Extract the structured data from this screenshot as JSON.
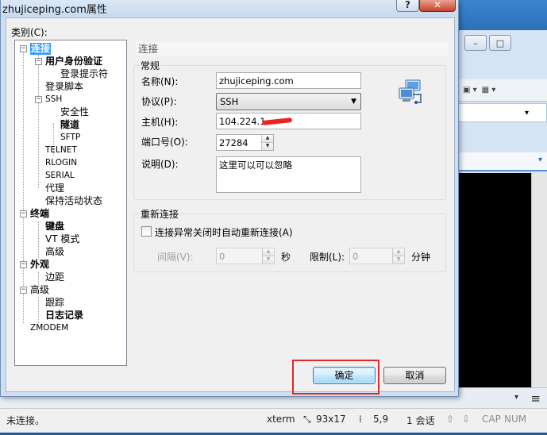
{
  "background_app": {
    "bottom_input_placeholder": "",
    "status_left": "未连接。",
    "status_terminal": "xterm",
    "status_size": "93x17",
    "status_cursor": "5,9",
    "status_sessions": "1 会话",
    "status_caps": "CAP",
    "status_num": "NUM"
  },
  "dialog": {
    "title": "zhujiceping.com属性",
    "help_button": "?",
    "close_button": "✕",
    "category_label": "类别(C):",
    "tree": [
      {
        "label": "连接",
        "bold": true,
        "selected": true
      },
      {
        "label": "用户身份验证",
        "bold": true
      },
      {
        "label": "登录提示符"
      },
      {
        "label": "登录脚本"
      },
      {
        "label": "SSH"
      },
      {
        "label": "安全性"
      },
      {
        "label": "隧道",
        "bold": true
      },
      {
        "label": "SFTP"
      },
      {
        "label": "TELNET"
      },
      {
        "label": "RLOGIN"
      },
      {
        "label": "SERIAL"
      },
      {
        "label": "代理"
      },
      {
        "label": "保持活动状态"
      },
      {
        "label": "终端",
        "bold": true
      },
      {
        "label": "键盘",
        "bold": true
      },
      {
        "label": "VT 模式"
      },
      {
        "label": "高级"
      },
      {
        "label": "外观",
        "bold": true
      },
      {
        "label": "边距"
      },
      {
        "label": "高级"
      },
      {
        "label": "跟踪"
      },
      {
        "label": "日志记录",
        "bold": true
      },
      {
        "label": "ZMODEM"
      }
    ],
    "pane_title": "连接",
    "general": {
      "legend": "常规",
      "name_label": "名称(N):",
      "name_value": "zhujiceping.com",
      "protocol_label": "协议(P):",
      "protocol_value": "SSH",
      "host_label": "主机(H):",
      "host_value": "104.224.1",
      "port_label": "端口号(O):",
      "port_value": "27284",
      "desc_label": "说明(D):",
      "desc_value": "这里可以可以忽略"
    },
    "reconnect": {
      "legend": "重新连接",
      "checkbox_label": "连接异常关闭时自动重新连接(A)",
      "checked": false,
      "interval_label": "间隔(V):",
      "interval_value": "0",
      "interval_unit": "秒",
      "limit_label": "限制(L):",
      "limit_value": "0",
      "limit_unit": "分钟"
    },
    "ok_button": "确定",
    "cancel_button": "取消",
    "highlight_color": "#e0292b"
  }
}
